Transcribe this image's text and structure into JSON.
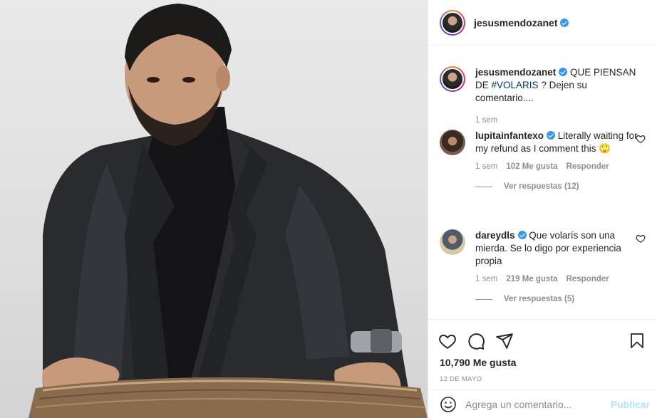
{
  "post": {
    "username": "jesusmendozanet",
    "caption_prefix": "QUE PIENSAN DE",
    "caption_tag": "#VOLARIS",
    "caption_suffix": "? Dejen su comentario....",
    "time": "1 sem"
  },
  "comments": [
    {
      "username": "lupitainfantexo",
      "text": "Literally waiting for my refund as I comment this 🙄",
      "time": "1 sem",
      "likes": "102 Me gusta",
      "reply_label": "Responder",
      "view_replies": "Ver respuestas (12)"
    },
    {
      "username": "dareydls",
      "text": "Que volarís son una mierda. Se lo digo por experiencia propia",
      "time": "1 sem",
      "likes": "219 Me gusta",
      "reply_label": "Responder",
      "view_replies": "Ver respuestas (5)"
    }
  ],
  "stats": {
    "likes": "10,790 Me gusta",
    "date": "12 DE MAYO"
  },
  "add_comment": {
    "placeholder": "Agrega un comentario...",
    "publish_label": "Publicar"
  },
  "icons": {
    "like": "heart-icon",
    "comment": "comment-bubble-icon",
    "share": "paper-plane-icon",
    "save": "bookmark-icon",
    "emoji": "smiley-icon",
    "verified": "verified-badge-icon"
  },
  "colors": {
    "verified": "#3897f0",
    "hashtag": "#00376b",
    "muted": "#8e8e8e",
    "publish_disabled": "#b2dffc"
  }
}
